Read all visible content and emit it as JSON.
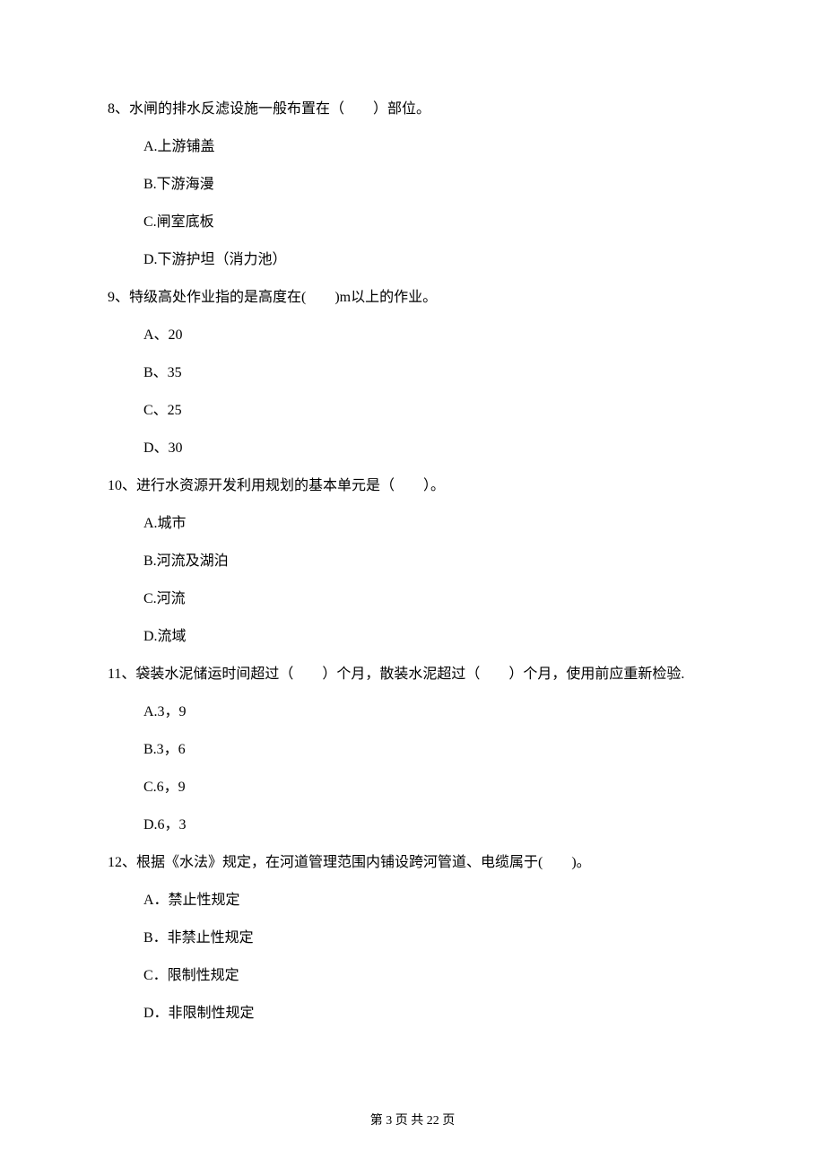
{
  "questions": [
    {
      "number": "8、",
      "text": "水闸的排水反滤设施一般布置在（　　）部位。",
      "options": [
        "A.上游铺盖",
        "B.下游海漫",
        "C.闸室底板",
        "D.下游护坦（消力池）"
      ]
    },
    {
      "number": "9、",
      "text": "特级高处作业指的是高度在(　　)m以上的作业。",
      "options": [
        "A、20",
        "B、35",
        "C、25",
        "D、30"
      ]
    },
    {
      "number": "10、",
      "text": "进行水资源开发利用规划的基本单元是（　　）。",
      "options": [
        "A.城市",
        "B.河流及湖泊",
        "C.河流",
        "D.流域"
      ]
    },
    {
      "number": "11、",
      "text": "袋装水泥储运时间超过（　　）个月，散装水泥超过（　　）个月，使用前应重新检验.",
      "options": [
        "A.3，9",
        "B.3，6",
        "C.6，9",
        "D.6，3"
      ]
    },
    {
      "number": "12、",
      "text": "根据《水法》规定，在河道管理范围内铺设跨河管道、电缆属于(　　)。",
      "options": [
        "A．禁止性规定",
        "B．非禁止性规定",
        "C．限制性规定",
        "D．非限制性规定"
      ]
    }
  ],
  "footer": "第 3 页 共 22 页"
}
